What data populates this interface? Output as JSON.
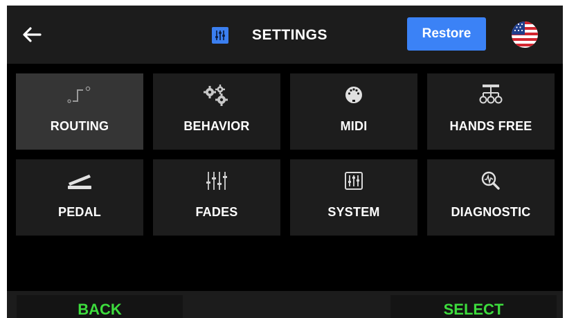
{
  "header": {
    "title": "SETTINGS",
    "restore_label": "Restore",
    "back_icon": "back-arrow-icon",
    "flag_icon": "us-flag-icon",
    "accent_color": "#3b82f6"
  },
  "tiles": [
    {
      "label": "ROUTING",
      "icon": "routing-icon",
      "selected": true
    },
    {
      "label": "BEHAVIOR",
      "icon": "gears-icon",
      "selected": false
    },
    {
      "label": "MIDI",
      "icon": "midi-connector-icon",
      "selected": false
    },
    {
      "label": "HANDS FREE",
      "icon": "hands-free-icon",
      "selected": false
    },
    {
      "label": "PEDAL",
      "icon": "pedal-icon",
      "selected": false
    },
    {
      "label": "FADES",
      "icon": "faders-icon",
      "selected": false
    },
    {
      "label": "SYSTEM",
      "icon": "system-icon",
      "selected": false
    },
    {
      "label": "DIAGNOSTIC",
      "icon": "diagnostic-icon",
      "selected": false
    }
  ],
  "footer": {
    "back_label": "BACK",
    "select_label": "SELECT",
    "action_color": "#3ddc3d"
  }
}
